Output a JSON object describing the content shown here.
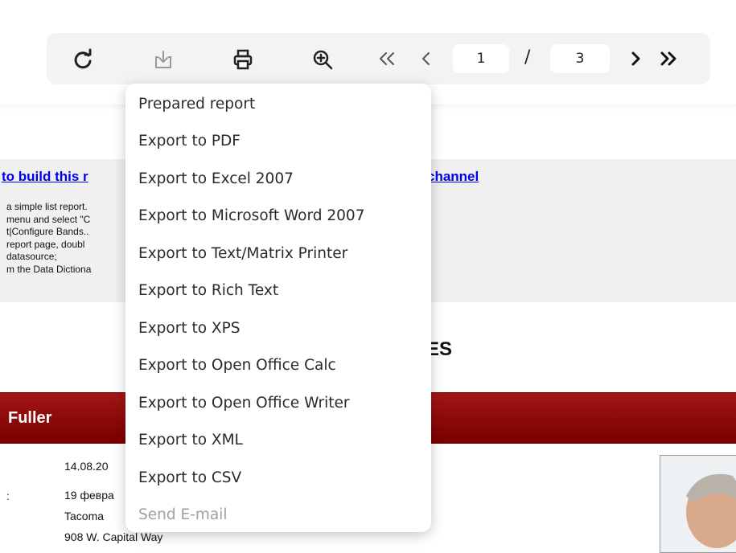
{
  "toolbar": {
    "buttons": [
      {
        "name": "refresh-icon"
      },
      {
        "name": "export-icon"
      },
      {
        "name": "print-icon"
      },
      {
        "name": "zoom-in-icon"
      },
      {
        "name": "first-page-icon"
      },
      {
        "name": "previous-page-icon"
      },
      {
        "name": "next-page-icon"
      },
      {
        "name": "last-page-icon"
      }
    ],
    "current_page": "1",
    "separator": "/",
    "total_pages": "3"
  },
  "export_menu": {
    "items": [
      {
        "label": "Prepared report",
        "enabled": true
      },
      {
        "label": "Export to PDF",
        "enabled": true
      },
      {
        "label": "Export to Excel 2007",
        "enabled": true
      },
      {
        "label": "Export to Microsoft Word 2007",
        "enabled": true
      },
      {
        "label": "Export to Text/Matrix Printer",
        "enabled": true
      },
      {
        "label": "Export to Rich Text",
        "enabled": true
      },
      {
        "label": "Export to XPS",
        "enabled": true
      },
      {
        "label": "Export to Open Office Calc",
        "enabled": true
      },
      {
        "label": "Export to Open Office Writer",
        "enabled": true
      },
      {
        "label": "Export to XML",
        "enabled": true
      },
      {
        "label": "Export to CSV",
        "enabled": true
      },
      {
        "label": "Send E-mail",
        "enabled": false
      }
    ]
  },
  "report": {
    "link_left": "to build this r",
    "link_right": "channel",
    "instructions": [
      "a simple list report.",
      "menu and select \"C",
      "t|Configure Bands..",
      "report page, doubl",
      "datasource;",
      "m the Data Dictiona"
    ],
    "title_fragment": "ES",
    "employee_name": "Fuller",
    "label_colon": ":",
    "employee_fields": [
      "14.08.20",
      "19 февра",
      "Tacoma",
      "908 W. Capital Way"
    ]
  },
  "colors": {
    "toolbar_bg": "#f3f3f3",
    "band_red": "#8b0000",
    "link": "#0000ee",
    "disabled_text": "#a0a0a0"
  }
}
